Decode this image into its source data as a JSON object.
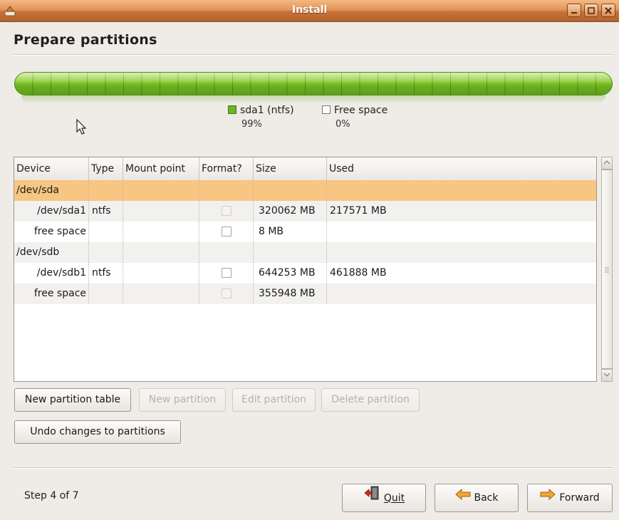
{
  "window": {
    "title": "Install"
  },
  "page": {
    "title": "Prepare partitions"
  },
  "partition_bar": {
    "color_used": "#7cbc2b",
    "legend": [
      {
        "label": "sda1 (ntfs)",
        "percent": "99%",
        "swatch": "#6ab623"
      },
      {
        "label": "Free space",
        "percent": "0%",
        "swatch": "#ffffff"
      }
    ]
  },
  "table": {
    "columns": [
      "Device",
      "Type",
      "Mount point",
      "Format?",
      "Size",
      "Used"
    ],
    "rows": [
      {
        "device": "/dev/sda",
        "type": "",
        "mount": "",
        "format": null,
        "size": "",
        "used": "",
        "selected": true,
        "indent": false
      },
      {
        "device": "/dev/sda1",
        "type": "ntfs",
        "mount": "",
        "format": "disabled",
        "size": "320062 MB",
        "used": "217571 MB",
        "selected": false,
        "indent": true
      },
      {
        "device": "free space",
        "type": "",
        "mount": "",
        "format": "enabled",
        "size": "8 MB",
        "used": "",
        "selected": false,
        "indent": true
      },
      {
        "device": "/dev/sdb",
        "type": "",
        "mount": "",
        "format": null,
        "size": "",
        "used": "",
        "selected": false,
        "indent": false
      },
      {
        "device": "/dev/sdb1",
        "type": "ntfs",
        "mount": "",
        "format": "enabled",
        "size": "644253 MB",
        "used": "461888 MB",
        "selected": false,
        "indent": true
      },
      {
        "device": "free space",
        "type": "",
        "mount": "",
        "format": "disabled",
        "size": "355948 MB",
        "used": "",
        "selected": false,
        "indent": true
      }
    ]
  },
  "actions": {
    "new_partition_table": "New partition table",
    "new_partition": "New partition",
    "edit_partition": "Edit partition",
    "delete_partition": "Delete partition",
    "undo_changes": "Undo changes to partitions"
  },
  "footer": {
    "step": "Step 4 of 7",
    "quit": "Quit",
    "back": "Back",
    "forward": "Forward"
  },
  "icons": {
    "app": "installer-icon",
    "quit": "quit-door-icon",
    "back": "arrow-left-icon",
    "forward": "arrow-right-icon"
  }
}
